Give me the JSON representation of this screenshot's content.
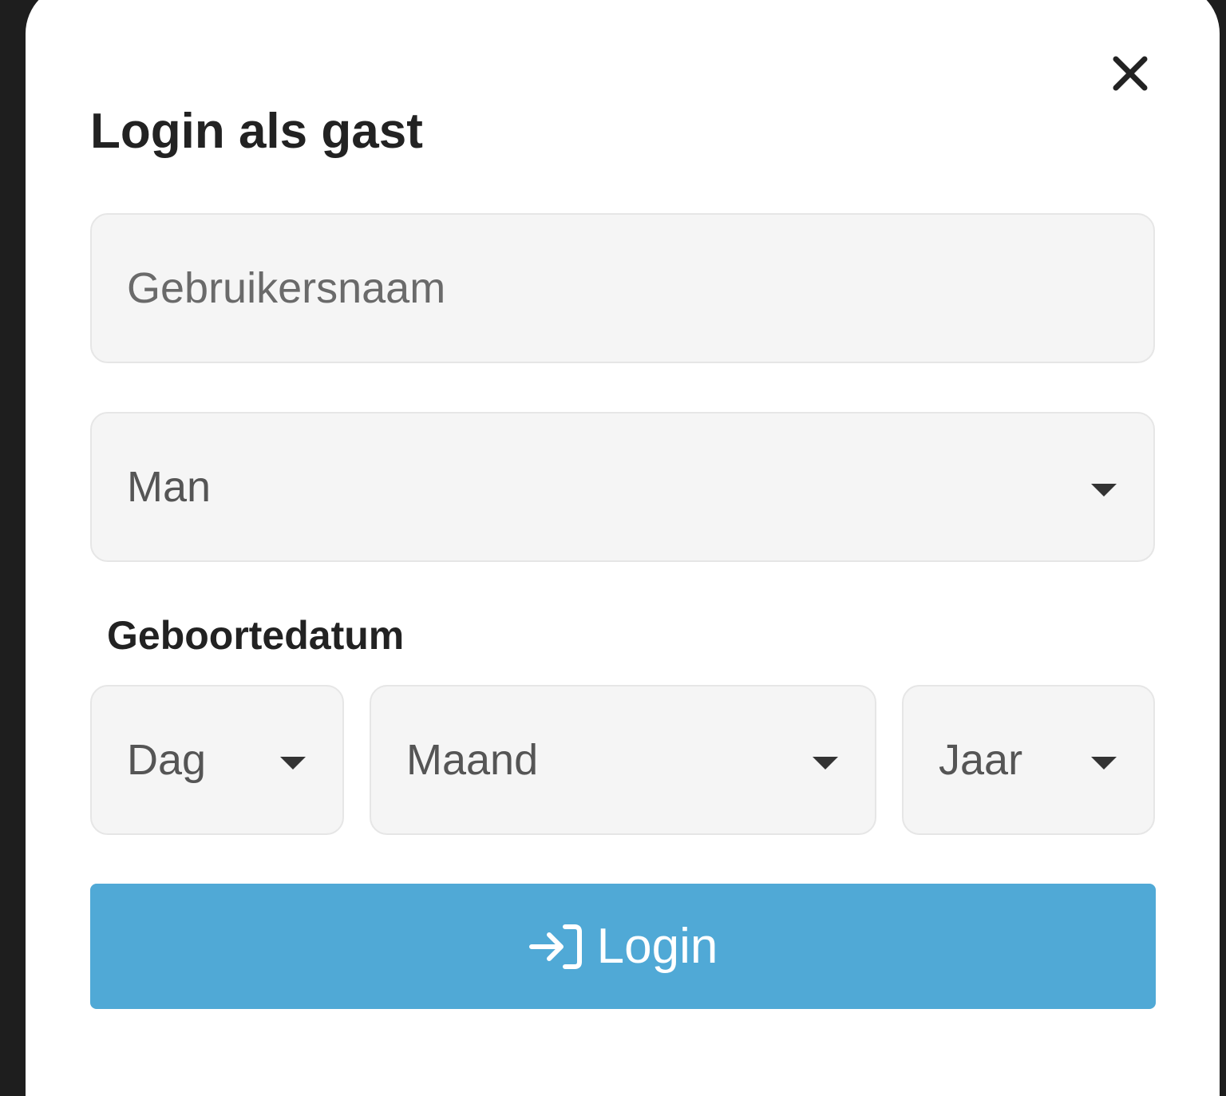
{
  "dialog": {
    "title": "Login als gast",
    "close_icon": "close-icon"
  },
  "form": {
    "username": {
      "value": "",
      "placeholder": "Gebruikersnaam"
    },
    "gender": {
      "selected": "Man"
    },
    "birthdate": {
      "label": "Geboortedatum",
      "day": {
        "selected": "Dag"
      },
      "month": {
        "selected": "Maand"
      },
      "year": {
        "selected": "Jaar"
      }
    },
    "submit": {
      "label": "Login",
      "icon": "login-icon"
    }
  },
  "colors": {
    "primary": "#50a9d6",
    "field_background": "#f5f5f5",
    "text_dark": "#222222"
  }
}
